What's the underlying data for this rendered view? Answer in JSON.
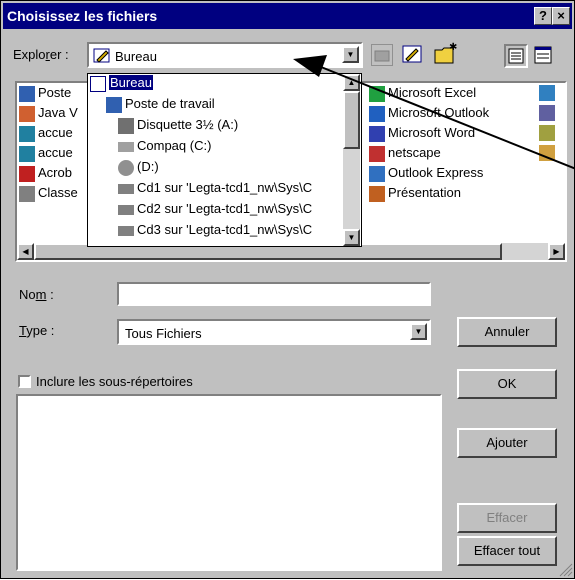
{
  "window": {
    "title": "Choisissez les fichiers",
    "help_btn": "?",
    "close_btn": "×"
  },
  "explorer": {
    "label_pre": "Explo",
    "label_ul": "r",
    "label_post": "er :",
    "value": "Bureau"
  },
  "file_list_left": [
    "Poste",
    "Java V",
    "accue",
    "accue",
    "Acrob",
    "Classe"
  ],
  "file_list_right": [
    "Microsoft Excel",
    "Microsoft Outlook",
    "Microsoft Word",
    "netscape",
    "Outlook Express",
    "Présentation"
  ],
  "dropdown": {
    "items": [
      {
        "label": "Bureau",
        "icon": "desktop-icon"
      },
      {
        "label": "Poste de travail",
        "icon": "computer-icon"
      },
      {
        "label": "Disquette 3½ (A:)",
        "icon": "floppy-icon"
      },
      {
        "label": "Compaq (C:)",
        "icon": "drive-icon"
      },
      {
        "label": "(D:)",
        "icon": "cdrom-icon"
      },
      {
        "label": "Cd1 sur 'Legta-tcd1_nw\\Sys\\C",
        "icon": "network-drive-icon"
      },
      {
        "label": "Cd2 sur 'Legta-tcd1_nw\\Sys\\C",
        "icon": "network-drive-icon"
      },
      {
        "label": "Cd3 sur 'Legta-tcd1_nw\\Sys\\C",
        "icon": "network-drive-icon"
      }
    ]
  },
  "nom": {
    "label_pre": "No",
    "label_ul": "m",
    "label_post": " :",
    "value": ""
  },
  "type": {
    "label_ul": "T",
    "label_post": "ype :",
    "value": "Tous Fichiers"
  },
  "checkbox": {
    "label": "Inclure les sous-répertoires",
    "checked": false
  },
  "buttons": {
    "annuler": "Annuler",
    "ok": "OK",
    "ajouter": "Ajouter",
    "effacer": "Effacer",
    "effacer_tout": "Effacer tout"
  },
  "colors": {
    "titlebar": "#000080",
    "face": "#c0c0c0",
    "highlight": "#000080"
  }
}
